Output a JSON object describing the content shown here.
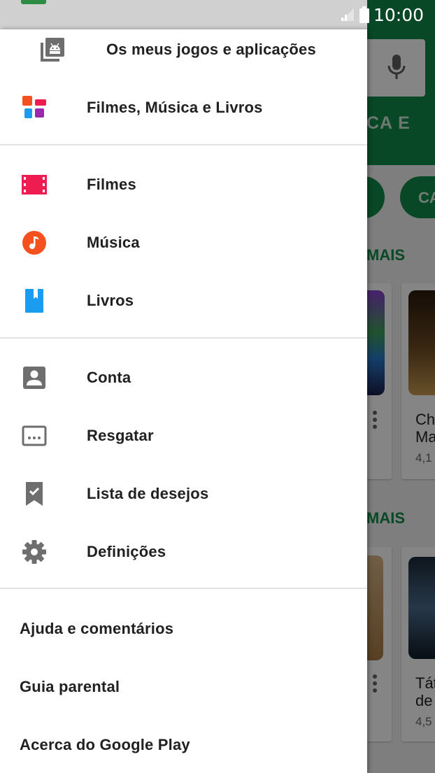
{
  "status_bar": {
    "time": "10:00"
  },
  "drawer": {
    "top_item": {
      "label": "Os meus jogos e aplicações",
      "icon": "my-apps-library-icon"
    },
    "media_hub": {
      "label": "Filmes, Música e Livros",
      "icon": "movies-music-books-icon"
    },
    "media_section": [
      {
        "label": "Filmes",
        "icon": "film-strip-icon",
        "color": "#ee1c50"
      },
      {
        "label": "Música",
        "icon": "music-note-icon",
        "color": "#f4511e"
      },
      {
        "label": "Livros",
        "icon": "book-icon",
        "color": "#1a9cf0"
      }
    ],
    "account_section": [
      {
        "label": "Conta",
        "icon": "account-icon"
      },
      {
        "label": "Resgatar",
        "icon": "redeem-icon"
      },
      {
        "label": "Lista de desejos",
        "icon": "wishlist-bookmark-icon"
      },
      {
        "label": "Definições",
        "icon": "settings-gear-icon"
      }
    ],
    "footer_links": [
      {
        "label": "Ajuda e comentários"
      },
      {
        "label": "Guia parental"
      },
      {
        "label": "Acerca do Google Play"
      }
    ]
  },
  "background": {
    "accent_color": "#108a4a",
    "tab_fragment": "CA E",
    "chip_fragment": "CA",
    "section_more_1": "MAIS",
    "section_more_2": "MAIS",
    "card_1_title": "Ch\nMa",
    "card_1_rating": "4,1",
    "card_2_title": "Tát\nde",
    "card_2_rating": "4,5"
  }
}
